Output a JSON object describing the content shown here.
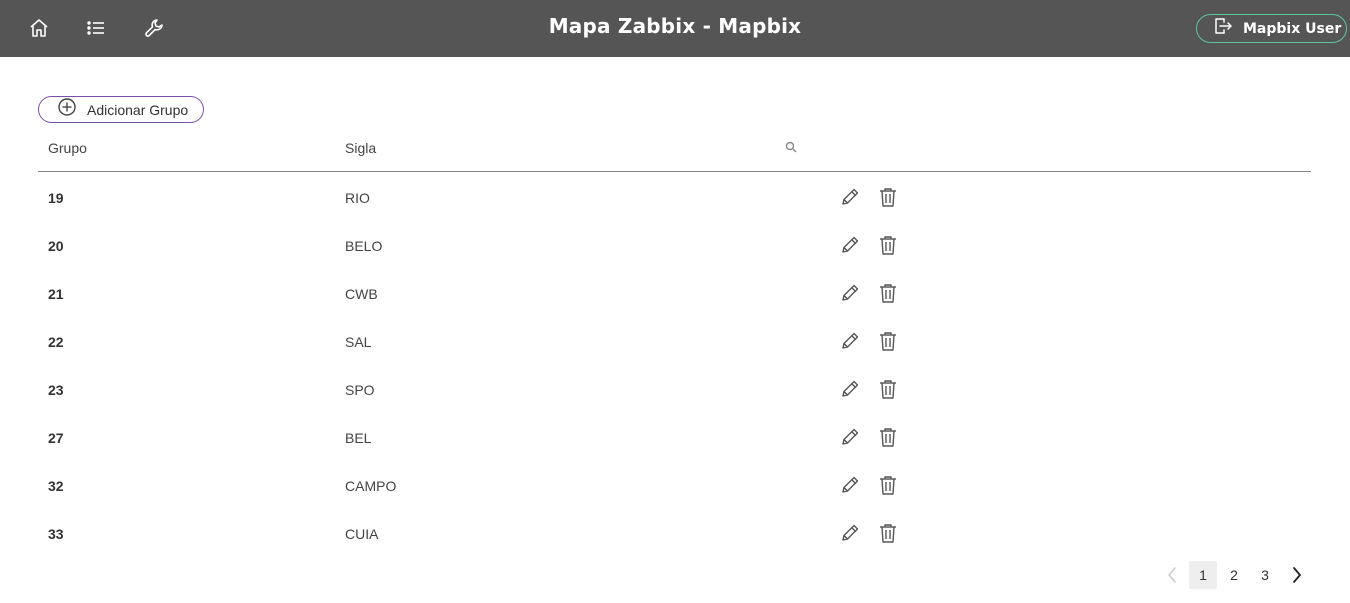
{
  "header": {
    "title": "Mapa Zabbix - Mapbix",
    "user_label": "Mapbix User",
    "nav": [
      "home-icon",
      "list-icon",
      "wrench-icon"
    ]
  },
  "toolbar": {
    "add_group_label": "Adicionar Grupo"
  },
  "table": {
    "columns": [
      "Grupo",
      "Sigla"
    ],
    "rows": [
      {
        "grupo": "19",
        "sigla": "RIO"
      },
      {
        "grupo": "20",
        "sigla": "BELO"
      },
      {
        "grupo": "21",
        "sigla": "CWB"
      },
      {
        "grupo": "22",
        "sigla": "SAL"
      },
      {
        "grupo": "23",
        "sigla": "SPO"
      },
      {
        "grupo": "27",
        "sigla": "BEL"
      },
      {
        "grupo": "32",
        "sigla": "CAMPO"
      },
      {
        "grupo": "33",
        "sigla": "CUIA"
      }
    ]
  },
  "pagination": {
    "pages": [
      "1",
      "2",
      "3"
    ],
    "current": "1"
  },
  "colors": {
    "topbar": "#555555",
    "user_border": "#5ec49a",
    "add_border": "#7a4fa6"
  }
}
